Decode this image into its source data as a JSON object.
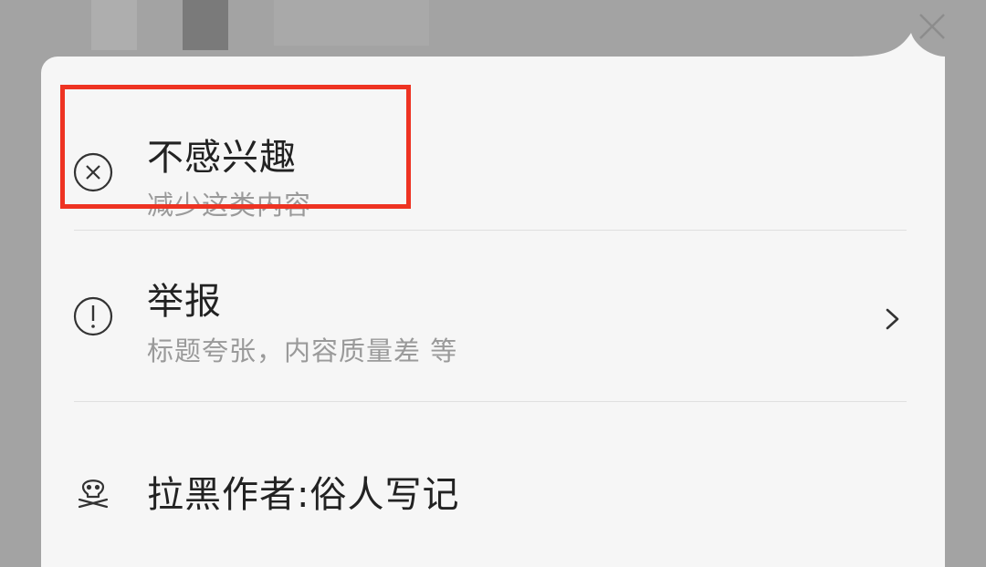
{
  "menu": {
    "items": [
      {
        "title": "不感兴趣",
        "subtitle": "减少这类内容",
        "icon": "circle-x-icon"
      },
      {
        "title": "举报",
        "subtitle": "标题夸张，内容质量差 等",
        "icon": "exclamation-circle-icon",
        "has_chevron": true
      },
      {
        "title": "拉黑作者:俗人写记",
        "icon": "skull-icon"
      }
    ]
  },
  "colors": {
    "highlight": "#ee3322",
    "panel": "#f6f6f6",
    "backdrop": "#a3a3a3",
    "title_text": "#222222",
    "subtitle_text": "#9a9a9a"
  }
}
